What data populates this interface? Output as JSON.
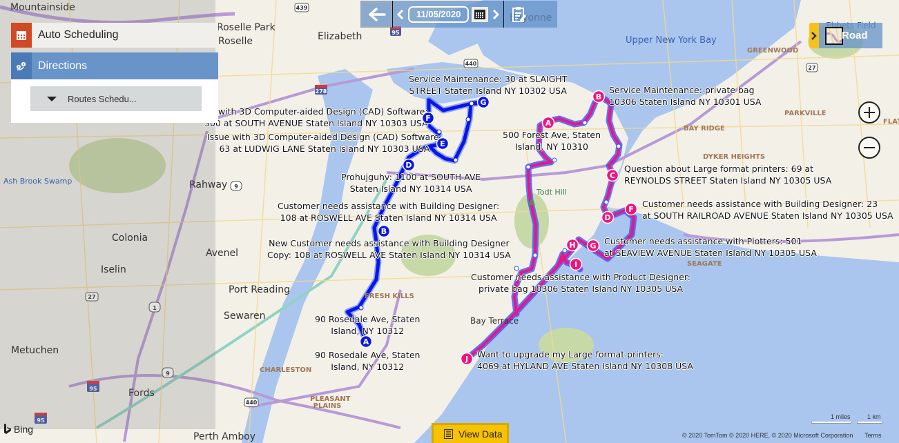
{
  "panel": {
    "auto_scheduling_label": "Auto Scheduling",
    "directions_label": "Directions",
    "routes_dropdown_label": "Routes Schedu..."
  },
  "toolbar": {
    "date": "11/05/2020"
  },
  "map_style": {
    "label": "Road"
  },
  "footer": {
    "view_data_label": "View Data",
    "bing_label": "Bing",
    "scale_miles": "1 miles",
    "scale_km": "1 km",
    "copyright": "© 2020 TomTom © 2020 HERE, © 2020 Microsoft Corporation",
    "terms": "Terms"
  },
  "colors": {
    "route_blue": "#0a16e6",
    "route_pink": "#f0157e",
    "accent_orange": "#d04a26",
    "accent_blue": "#6894c9",
    "view_data_yellow": "#f7c200"
  },
  "map_labels": {
    "places": [
      "Mountainside",
      "Roselle Park",
      "Roselle",
      "Elizabeth",
      "Bayonne",
      "Rahway",
      "Colonia",
      "Avenel",
      "Iselin",
      "Port Reading",
      "Sewaren",
      "Metuchen",
      "Fords",
      "Perth Amboy",
      "Bay Terrace",
      "Todt Hill",
      "Ebbets Field"
    ],
    "neighborhoods": [
      "GREENWOOD",
      "PARKVILLE",
      "BAY RIDGE",
      "DYKER HEIGHTS",
      "SEAGATE",
      "FRESH KILLS",
      "CHARLESTON",
      "PLEASANT PLAINS",
      "FLATBUSH"
    ],
    "water": [
      "Upper New York Bay",
      "Ash Brook Swamp"
    ],
    "highway_shields": [
      "439",
      "95",
      "440",
      "278",
      "27",
      "9",
      "1",
      "440",
      "95",
      "9"
    ]
  },
  "routes": [
    {
      "name": "blue-route",
      "stops": [
        {
          "letter": "A",
          "label": "90 Rosedale Ave, Staten Island, NY 10312"
        },
        {
          "letter": "B",
          "label": "Customer needs assistance with Building Designer: 108 at ROSWELL AVE Staten Island NY 10314 USA"
        },
        {
          "letter": "D",
          "label": "Prohujguhv: 1100 at SOUTH AVE Staten Island NY 10314 USA"
        },
        {
          "letter": "E",
          "label": "Issue with 3D Computer-aided Design (CAD) Software: 63 at LUDWIG LANE Staten Island NY 10303 USA"
        },
        {
          "letter": "F",
          "label": "with 3D Computer-aided Design (CAD) Software: 300 at SOUTH AVENUE Staten Island NY 10303 USA"
        },
        {
          "letter": "G",
          "label": "Service Maintenance: 30 at SLAIGHT STREET Staten Island NY 10302 USA"
        }
      ],
      "extra_labels": [
        "New Customer needs assistance with Building Designer Copy: 108 at ROSWELL AVE Staten Island NY 10314 USA",
        "90 Rosedale Ave, Staten Island, NY 10312"
      ]
    },
    {
      "name": "pink-route",
      "stops": [
        {
          "letter": "A",
          "label": "500 Forest Ave, Staten Island, NY 10310"
        },
        {
          "letter": "B",
          "label": "Service Maintenance: private bag 10306 Staten Island NY 10301 USA"
        },
        {
          "letter": "C",
          "label": "Question about Large format printers: 69 at REYNOLDS STREET Staten Island NY 10305 USA"
        },
        {
          "letter": "D",
          "label": ""
        },
        {
          "letter": "F",
          "label": "Customer needs assistance with Building Designer: 23 at SOUTH RAILROAD AVENUE Staten Island NY 10305 USA"
        },
        {
          "letter": "G",
          "label": "Customer needs assistance with Plotters: 501 at SEAVIEW AVENUE Staten Island NY 10305 USA"
        },
        {
          "letter": "H",
          "label": ""
        },
        {
          "letter": "I",
          "label": "Customer needs assistance with Product Designer: private bag 10306 Staten Island NY 10305 USA"
        },
        {
          "letter": "J",
          "label": "Want to upgrade my Large format printers: 4069 at HYLAND AVE Staten Island NY 10308 USA"
        }
      ]
    }
  ],
  "stop_labels": {
    "blue_g_1": "Service Maintenance: 30 at SLAIGHT",
    "blue_g_2": "STREET Staten Island NY 10302 USA",
    "blue_f_1": "with 3D Computer-aided Design (CAD) Software:",
    "blue_f_2": "300 at SOUTH AVENUE Staten Island NY 10303 USA",
    "blue_e_1": "Issue with 3D Computer-aided Design (CAD) Software:",
    "blue_e_2": "63 at LUDWIG LANE Staten Island NY 10303 USA",
    "blue_d_1": "Prohujguhv: 1100 at SOUTH AVE",
    "blue_d_2": "Staten Island NY 10314 USA",
    "blue_b_1": "Customer needs assistance with Building Designer:",
    "blue_b_2": "108 at ROSWELL AVE Staten Island NY 10314 USA",
    "blue_b2_1": "New Customer needs assistance with Building Designer",
    "blue_b2_2": "Copy: 108 at ROSWELL AVE Staten Island NY 10314 USA",
    "blue_a_1": "90 Rosedale Ave, Staten",
    "blue_a_2": "Island, NY 10312",
    "blue_a2_1": "90 Rosedale Ave, Staten",
    "blue_a2_2": "Island, NY 10312",
    "pink_a_1": "500 Forest Ave, Staten",
    "pink_a_2": "Island, NY 10310",
    "pink_b_1": "Service Maintenance: private bag",
    "pink_b_2": "10306 Staten Island NY 10301 USA",
    "pink_c_1": "Question about Large format printers: 69 at",
    "pink_c_2": "REYNOLDS STREET Staten Island NY 10305 USA",
    "pink_f_1": "Customer needs assistance with Building Designer: 23",
    "pink_f_2": "at SOUTH RAILROAD AVENUE Staten Island NY 10305 USA",
    "pink_g_1": "Customer needs assistance with Plotters: 501",
    "pink_g_2": "at SEAVIEW AVENUE Staten Island NY 10305 USA",
    "pink_i_1": "Customer needs assistance with Product Designer:",
    "pink_i_2": "private bag 10306 Staten Island NY 10305 USA",
    "pink_j_1": "Want to upgrade my Large format printers:",
    "pink_j_2": "4069 at HYLAND AVE Staten Island NY 10308 USA"
  },
  "markers": {
    "blue": [
      "A",
      "B",
      "D",
      "E",
      "F",
      "G"
    ],
    "pink": [
      "A",
      "B",
      "C",
      "D",
      "F",
      "G",
      "H",
      "I",
      "J"
    ]
  }
}
